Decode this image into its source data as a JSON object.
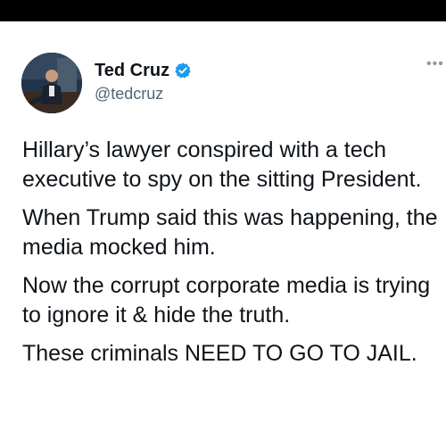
{
  "tweet": {
    "author": {
      "display_name": "Ted Cruz",
      "handle": "@tedcruz",
      "verified_icon": "verified-badge-icon",
      "avatar": "profile-photo"
    },
    "more_icon": "more-options-icon",
    "paragraphs": [
      "Hillary’s lawyer conspired with a tech executive to spy on the sitting President.",
      "When Trump said this was happening, the media mocked him.",
      "Now the corrupt corporate media is trying to ignore it & hide the truth.",
      "These criminals NEED TO GO TO JAIL."
    ]
  },
  "colors": {
    "text": "#0f1419",
    "secondary": "#536471",
    "verified": "#1d9bf0",
    "top_bar": "#000000"
  }
}
